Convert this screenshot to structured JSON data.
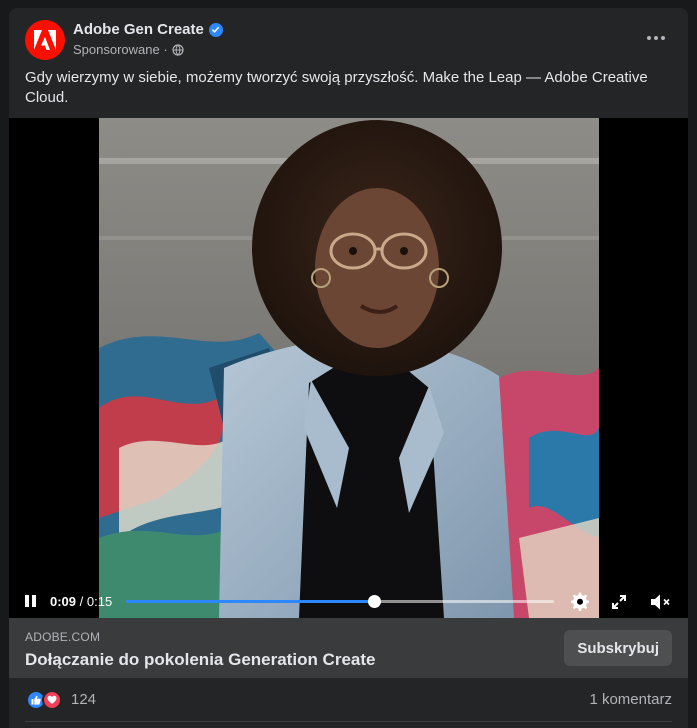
{
  "post": {
    "author": "Adobe Gen Create",
    "verified_icon": "verified-badge-icon",
    "meta": "Sponsorowane ·",
    "privacy_icon": "globe-icon",
    "more_icon": "more-options-icon",
    "caption": "Gdy wierzymy w siebie, możemy tworzyć swoją przyszłość. Make the Leap — Adobe Creative Cloud."
  },
  "video": {
    "current_time": "0:09",
    "separator": " / ",
    "duration": "0:15",
    "progress_fraction": 0.58,
    "play_state_icon": "pause-icon",
    "settings_icon": "gear-icon",
    "fullscreen_icon": "fullscreen-icon",
    "volume_icon": "muted-speaker-icon"
  },
  "link": {
    "domain": "ADOBE.COM",
    "title": "Dołączanie do pokolenia Generation Create",
    "cta": "Subskrybuj"
  },
  "reactions": {
    "icons": [
      "like-icon",
      "love-icon"
    ],
    "count": "124",
    "comments": "1 komentarz"
  },
  "colors": {
    "background": "#18191a",
    "card": "#242526",
    "accent": "#2d88ff",
    "adobe_red": "#fa0f00",
    "love": "#f33e58"
  }
}
